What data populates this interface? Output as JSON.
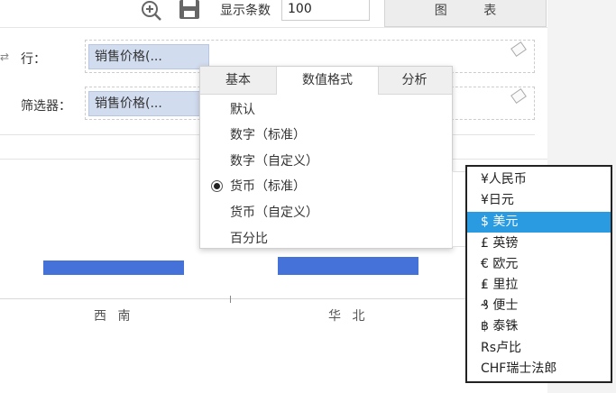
{
  "toolbar": {
    "count_label": "显示条数",
    "count_value": "100",
    "chart_tab": "图 表"
  },
  "fields": {
    "rows_label": "行：",
    "rows_pill": "销售价格(...",
    "filter_label": "筛选器：",
    "filter_pill": "销售价格(..."
  },
  "popup": {
    "tabs": [
      "基本",
      "数值格式",
      "分析"
    ],
    "active_tab": "数值格式",
    "options": [
      "默认",
      "数字（标准）",
      "数字（自定义）",
      "货币（标准）",
      "货币（自定义）",
      "百分比"
    ],
    "selected_option": "货币（标准）"
  },
  "currency_menu": {
    "items": [
      "¥人民币",
      "¥日元",
      "$ 美元",
      "£ 英镑",
      "€ 欧元",
      "₤ 里拉",
      "₰ 便士",
      "฿ 泰铢",
      "Rs卢比",
      "CHF瑞士法郎"
    ],
    "selected": "$ 美元",
    "highlight_color": "#2a9be0"
  },
  "chart": {
    "x_labels": [
      "西 南",
      "华 北"
    ],
    "bar_color": "#4472d9"
  }
}
